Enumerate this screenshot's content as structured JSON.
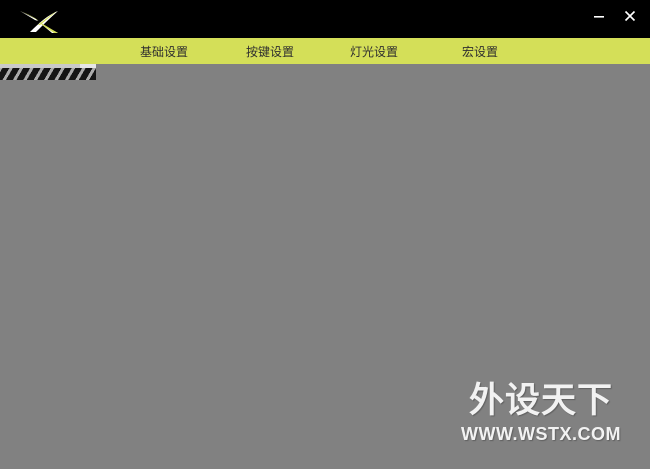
{
  "window": {
    "minimize_icon": "minimize-icon",
    "close_icon": "close-icon",
    "logo_icon": "x-logo-icon"
  },
  "nav": {
    "tabs": [
      {
        "label": "基础设置"
      },
      {
        "label": "按键设置"
      },
      {
        "label": "灯光设置"
      },
      {
        "label": "宏设置"
      }
    ]
  },
  "watermark": {
    "title": "外设天下",
    "url": "WWW.WSTX.COM"
  },
  "colors": {
    "titlebar_bg": "#000000",
    "navbar_bg": "#d4df58",
    "content_bg": "#818181",
    "nav_text": "#2f2f2f",
    "watermark_text": "#f2f2f2"
  }
}
